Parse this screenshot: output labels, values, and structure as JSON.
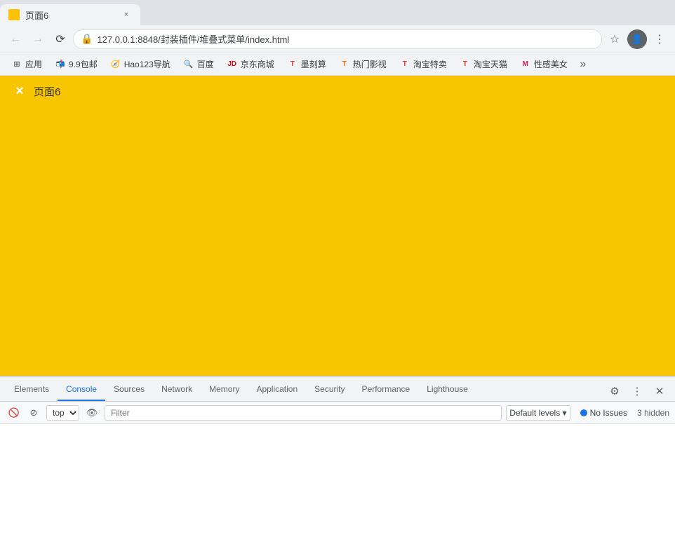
{
  "browser": {
    "tab": {
      "title": "页面6",
      "favicon_color": "#ffc107"
    },
    "nav": {
      "back_disabled": true,
      "forward_disabled": true,
      "url": "127.0.0.1:8848/封装插件/堆叠式菜单/index.html"
    },
    "bookmarks": [
      {
        "id": "apps",
        "label": "应用",
        "icon": "⊞"
      },
      {
        "id": "99mail",
        "label": "9.9包邮",
        "icon": "📬"
      },
      {
        "id": "hao123",
        "label": "Hao123导航",
        "icon": "🧭"
      },
      {
        "id": "baidu",
        "label": "百度",
        "icon": "🔍"
      },
      {
        "id": "jd",
        "label": "京东商城",
        "icon": "🛒"
      },
      {
        "id": "moji",
        "label": "墨刻算",
        "icon": "📱"
      },
      {
        "id": "hotmovie",
        "label": "热门影视",
        "icon": "🎬"
      },
      {
        "id": "taobao_sale",
        "label": "淘宝特卖",
        "icon": "🏷"
      },
      {
        "id": "taobao_tmall",
        "label": "淘宝天猫",
        "icon": "🏪"
      },
      {
        "id": "meitui",
        "label": "性感美女",
        "icon": "💄"
      }
    ]
  },
  "page": {
    "background_color": "#f7c600",
    "close_label": "×",
    "title": "页面6"
  },
  "devtools": {
    "tabs": [
      {
        "id": "elements",
        "label": "Elements",
        "active": false
      },
      {
        "id": "console",
        "label": "Console",
        "active": true
      },
      {
        "id": "sources",
        "label": "Sources",
        "active": false
      },
      {
        "id": "network",
        "label": "Network",
        "active": false
      },
      {
        "id": "memory",
        "label": "Memory",
        "active": false
      },
      {
        "id": "application",
        "label": "Application",
        "active": false
      },
      {
        "id": "security",
        "label": "Security",
        "active": false
      },
      {
        "id": "performance",
        "label": "Performance",
        "active": false
      },
      {
        "id": "lighthouse",
        "label": "Lighthouse",
        "active": false
      }
    ],
    "console": {
      "context_selector": "top",
      "filter_placeholder": "Filter",
      "levels_label": "Default levels ▾",
      "no_issues_label": "No Issues",
      "hidden_count": "3 hidden"
    },
    "settings_icon": "⚙",
    "more_icon": "⋮",
    "close_icon": "✕"
  }
}
